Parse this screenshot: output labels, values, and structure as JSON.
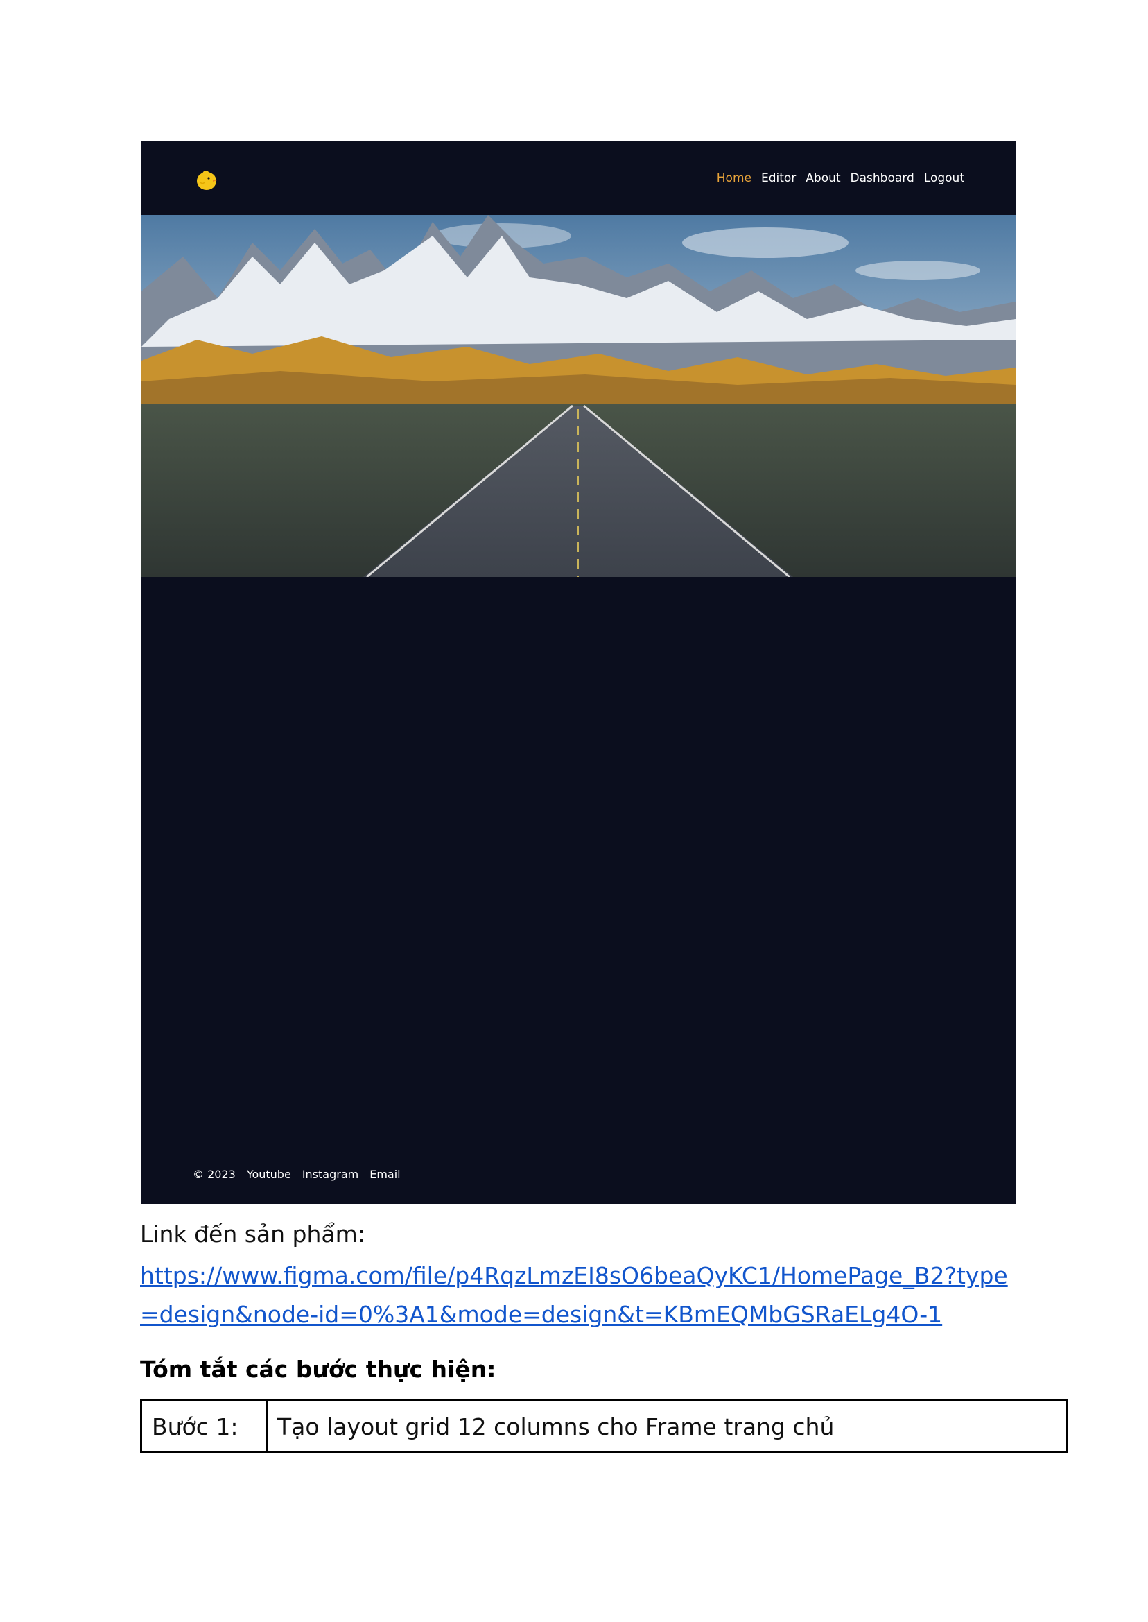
{
  "frame": {
    "nav": {
      "items": [
        {
          "label": "Home",
          "active": true
        },
        {
          "label": "Editor",
          "active": false
        },
        {
          "label": "About",
          "active": false
        },
        {
          "label": "Dashboard",
          "active": false
        },
        {
          "label": "Logout",
          "active": false
        }
      ]
    },
    "footer": {
      "copyright": "© 2023",
      "links": [
        "Youtube",
        "Instagram",
        "Email"
      ]
    },
    "colors": {
      "background": "#0b0e1e",
      "nav_active": "#e8a33a",
      "logo": "#f5c518"
    }
  },
  "document": {
    "link_label": "Link đến sản phẩm:",
    "link_url": "https://www.figma.com/file/p4RqzLmzEI8sO6beaQyKC1/HomePage_B2?type=design&node-id=0%3A1&mode=design&t=KBmEQMbGSRaELg4O-1",
    "summary_heading": "Tóm tắt các bước thực hiện:",
    "steps": [
      {
        "label": "Bước 1:",
        "text": "Tạo layout grid 12 columns cho Frame trang chủ"
      }
    ]
  }
}
